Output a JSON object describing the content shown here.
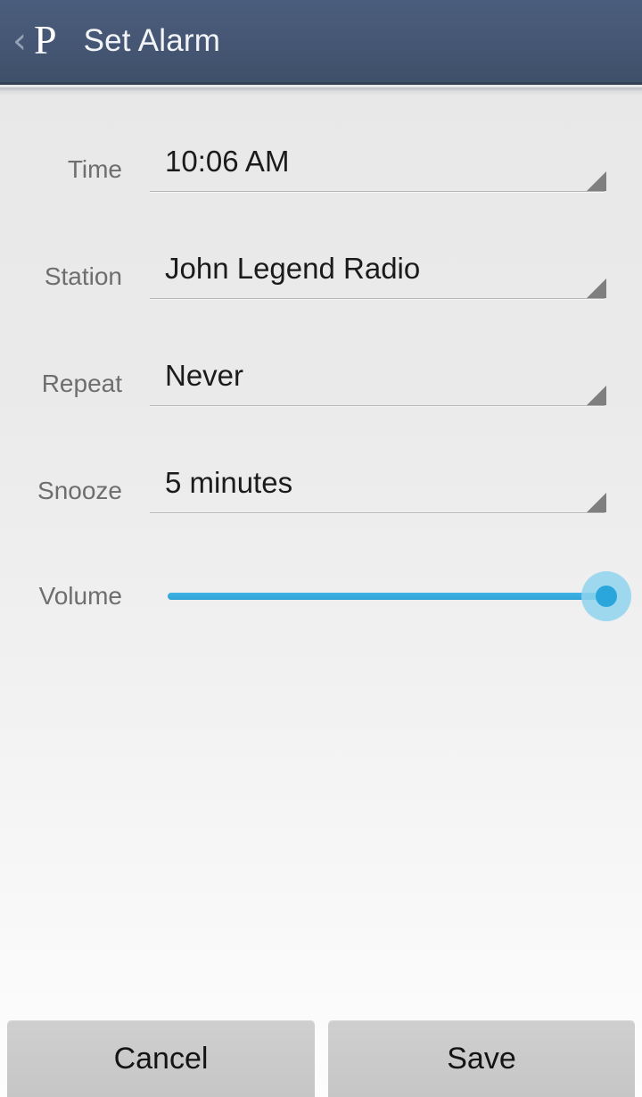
{
  "header": {
    "back_icon": "chevron-left-icon",
    "brand_logo": "pandora-p-logo",
    "brand_letter": "P",
    "back_glyph": "‹",
    "title": "Set Alarm"
  },
  "form": {
    "rows": [
      {
        "label": "Time",
        "value": "10:06 AM",
        "caret_icon": "dropdown-triangle-icon"
      },
      {
        "label": "Station",
        "value": "John Legend Radio",
        "caret_icon": "dropdown-triangle-icon"
      },
      {
        "label": "Repeat",
        "value": "Never",
        "caret_icon": "dropdown-triangle-icon"
      },
      {
        "label": "Snooze",
        "value": "5 minutes",
        "caret_icon": "dropdown-triangle-icon"
      }
    ],
    "volume": {
      "label": "Volume",
      "percent": 100
    }
  },
  "footer": {
    "cancel_label": "Cancel",
    "save_label": "Save"
  },
  "colors": {
    "header_bg": "#455774",
    "header_border": "#333f52",
    "page_bg_top": "#e8e8e8",
    "page_bg_bottom": "#fbfbfb",
    "label_text": "#6e6e6e",
    "value_text": "#1b1b1b",
    "underline": "#b6b6b6",
    "caret": "#7f7f7f",
    "slider_fill": "#2ea3d6",
    "slider_halo": "#8ed3ef",
    "slider_thumb": "#2aa6dc",
    "button_bg": "#cacaca"
  }
}
